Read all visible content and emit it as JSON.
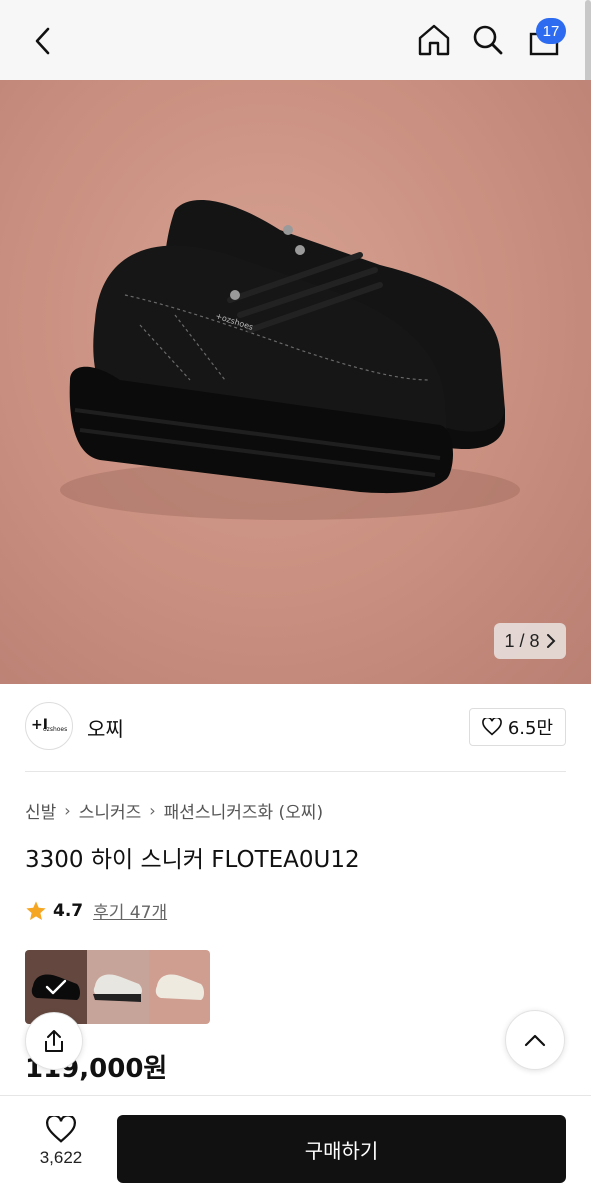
{
  "header": {
    "back_icon": "chevron-left-icon",
    "home_icon": "home-icon",
    "search_icon": "search-icon",
    "cart_icon": "shopping-bag-icon",
    "cart_badge": "17",
    "badge_color": "#2d6cf0"
  },
  "gallery": {
    "counter": "1 / 8",
    "next_icon": "chevron-right-icon"
  },
  "brand": {
    "name": "오찌",
    "logo_text": "+ozshoes",
    "likes": "6.5만"
  },
  "breadcrumb": [
    "신발",
    "스니커즈",
    "패션스니커즈화 (오찌)"
  ],
  "product": {
    "title": "3300 하이 스니커 FLOTEA0U12",
    "rating": "4.7",
    "review_label": "후기 47개",
    "price": "119,000원"
  },
  "swatches": [
    {
      "name": "black",
      "selected": true
    },
    {
      "name": "black-white",
      "selected": false
    },
    {
      "name": "cream",
      "selected": false
    }
  ],
  "bottom": {
    "wish_count": "3,622",
    "buy_label": "구매하기"
  },
  "colors": {
    "accent": "#111111",
    "star": "#f5a623",
    "hero_bg": "#c98f80"
  }
}
